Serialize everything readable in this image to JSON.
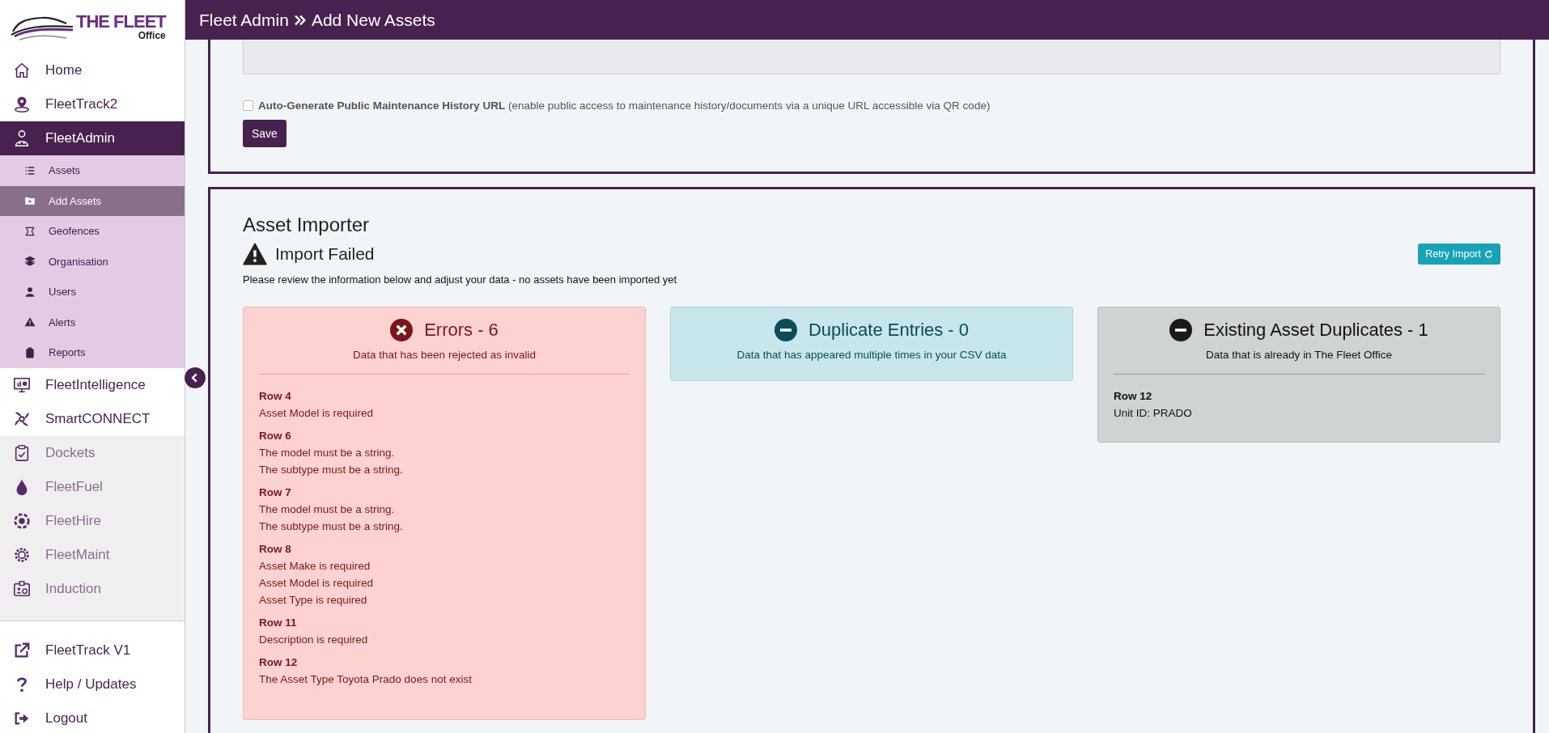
{
  "logo": {
    "title": "THE FLEET",
    "subtitle": "Office"
  },
  "header": {
    "breadcrumb": [
      "Fleet Admin",
      "Add New Assets"
    ]
  },
  "sidebar": {
    "items": [
      {
        "label": "Home",
        "selected": false,
        "disabled": false
      },
      {
        "label": "FleetTrack2",
        "selected": false,
        "disabled": false
      },
      {
        "label": "FleetAdmin",
        "selected": true,
        "disabled": false,
        "children": [
          {
            "label": "Assets",
            "selected": false
          },
          {
            "label": "Add Assets",
            "selected": true
          },
          {
            "label": "Geofences",
            "selected": false
          },
          {
            "label": "Organisation",
            "selected": false
          },
          {
            "label": "Users",
            "selected": false
          },
          {
            "label": "Alerts",
            "selected": false
          },
          {
            "label": "Reports",
            "selected": false
          }
        ]
      },
      {
        "label": "FleetIntelligence",
        "selected": false,
        "disabled": false
      },
      {
        "label": "SmartCONNECT",
        "selected": false,
        "disabled": false
      },
      {
        "label": "Dockets",
        "selected": false,
        "disabled": true
      },
      {
        "label": "FleetFuel",
        "selected": false,
        "disabled": true
      },
      {
        "label": "FleetHire",
        "selected": false,
        "disabled": true
      },
      {
        "label": "FleetMaint",
        "selected": false,
        "disabled": true
      },
      {
        "label": "Induction",
        "selected": false,
        "disabled": true
      }
    ],
    "footer_items": [
      {
        "label": "FleetTrack V1"
      },
      {
        "label": "Help / Updates"
      },
      {
        "label": "Logout"
      }
    ]
  },
  "form": {
    "checkbox": {
      "checked": false,
      "label": "Auto-Generate Public Maintenance History URL",
      "note": "(enable public access to maintenance history/documents via a unique URL accessible via QR code)"
    },
    "save_button": "Save"
  },
  "importer": {
    "title": "Asset Importer",
    "status": "Import Failed",
    "message": "Please review the information below and adjust your data - no assets have been imported yet",
    "retry_button": "Retry Import",
    "cards": [
      {
        "kind": "errors",
        "title": "Errors - 6",
        "subtitle": "Data that has been rejected as invalid",
        "entries": [
          {
            "row": "Row 4",
            "messages": [
              "Asset Model is required"
            ]
          },
          {
            "row": "Row 6",
            "messages": [
              "The model must be a string.",
              "The subtype must be a string."
            ]
          },
          {
            "row": "Row 7",
            "messages": [
              "The model must be a string.",
              "The subtype must be a string."
            ]
          },
          {
            "row": "Row 8",
            "messages": [
              "Asset Make is required",
              "Asset Model is required",
              "Asset Type is required"
            ]
          },
          {
            "row": "Row 11",
            "messages": [
              "Description is required"
            ]
          },
          {
            "row": "Row 12",
            "messages": [
              "The Asset Type Toyota Prado does not exist"
            ]
          }
        ]
      },
      {
        "kind": "duplicates",
        "title": "Duplicate Entries - 0",
        "subtitle": "Data that has appeared multiple times in your CSV data"
      },
      {
        "kind": "existing",
        "title": "Existing Asset Duplicates - 1",
        "subtitle": "Data that is already in The Fleet Office",
        "entries": [
          {
            "row": "Row 12",
            "messages": [
              "Unit ID: PRADO"
            ]
          }
        ]
      }
    ]
  }
}
